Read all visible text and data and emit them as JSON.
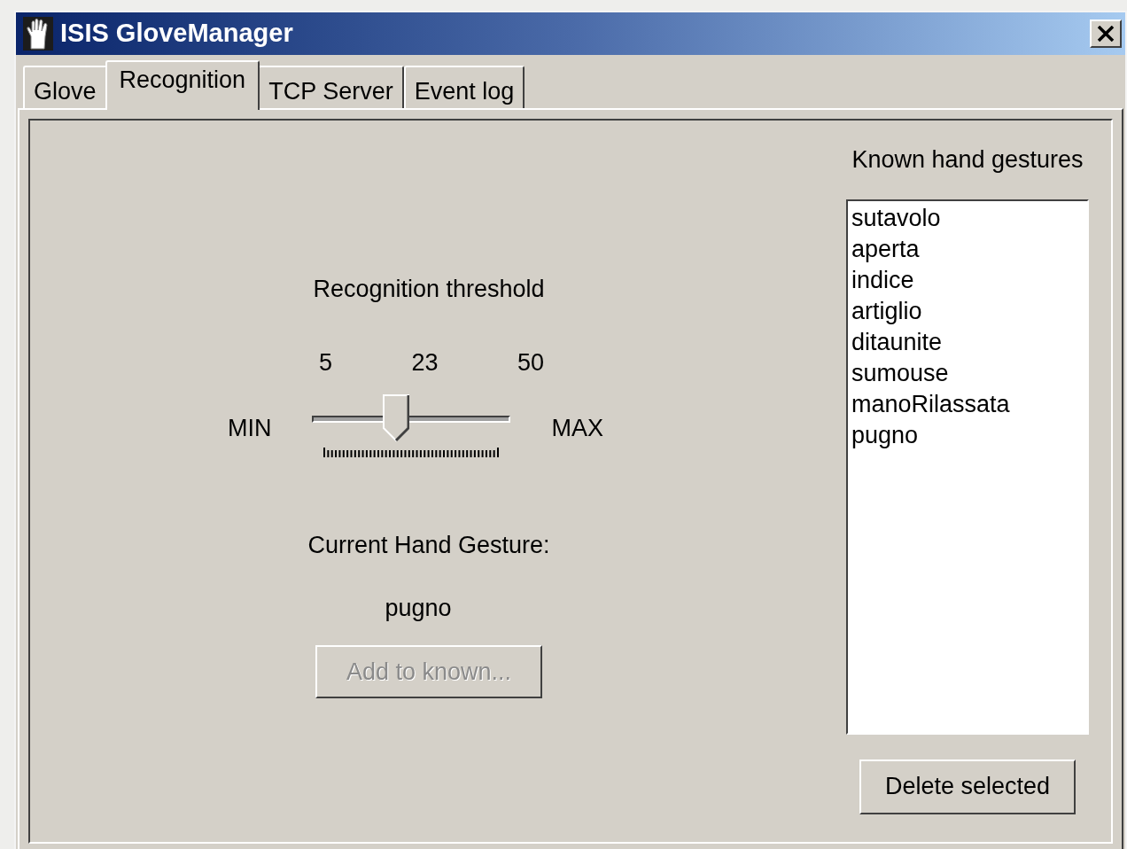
{
  "window": {
    "title": "ISIS GloveManager"
  },
  "tabs": [
    {
      "label": "Glove",
      "selected": false
    },
    {
      "label": "Recognition",
      "selected": true
    },
    {
      "label": "TCP Server",
      "selected": false
    },
    {
      "label": "Event log",
      "selected": false
    }
  ],
  "recognition": {
    "threshold_label": "Recognition threshold",
    "scale": {
      "min_value": "5",
      "current_value": "23",
      "max_value": "50",
      "min_label": "MIN",
      "max_label": "MAX"
    },
    "slider": {
      "level": 0.4
    },
    "current_gesture_label": "Current Hand Gesture:",
    "current_gesture": "pugno",
    "add_button": {
      "label": "Add to known...",
      "disabled": true
    }
  },
  "gestures": {
    "title": "Known hand gestures",
    "items": [
      {
        "label": "sutavolo",
        "selected": false
      },
      {
        "label": "aperta",
        "selected": false
      },
      {
        "label": "indice",
        "selected": false
      },
      {
        "label": "artiglio",
        "selected": false
      },
      {
        "label": "ditaunite",
        "selected": false
      },
      {
        "label": "sumouse",
        "selected": false
      },
      {
        "label": "manoRilassata",
        "selected": false
      },
      {
        "label": "pugno",
        "selected": false
      }
    ],
    "delete_button": {
      "label": "Delete selected"
    }
  }
}
